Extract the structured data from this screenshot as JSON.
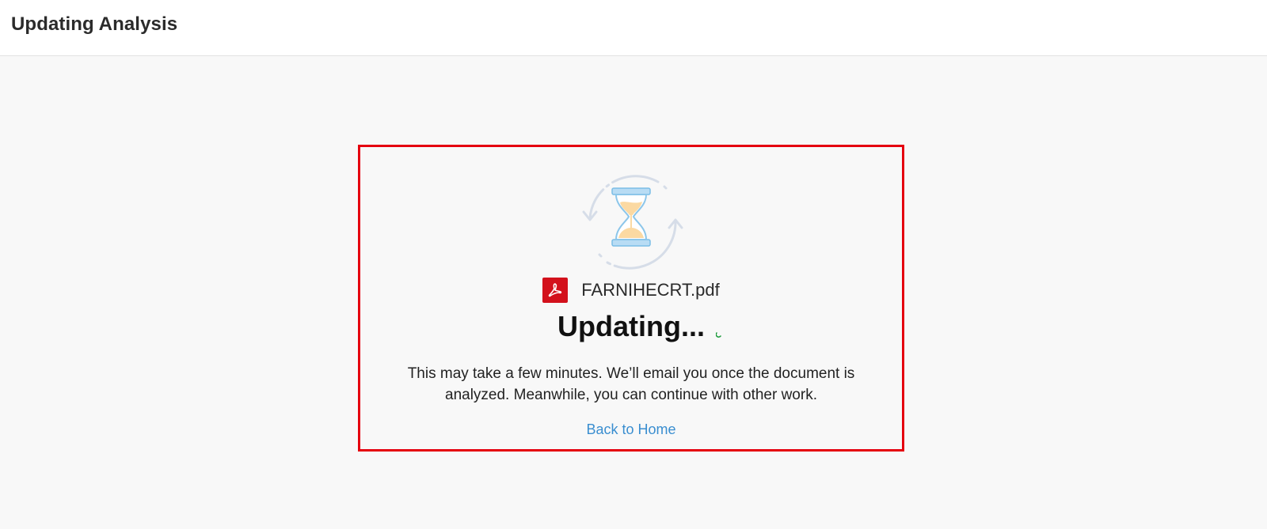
{
  "header": {
    "title": "Updating Analysis"
  },
  "card": {
    "illustration_icon": "hourglass-refresh-icon",
    "file": {
      "icon": "pdf-file-icon",
      "name": "FARNIHECRT.pdf"
    },
    "status_title": "Updating...",
    "description": "This may take a few minutes. We’ll email you once the document is analyzed. Meanwhile, you can continue with other work.",
    "back_link": "Back to Home"
  },
  "colors": {
    "highlight_border": "#e5000f",
    "pdf_icon_bg": "#d3111c",
    "link": "#3a8ed0",
    "spinner": "#1a9a3a",
    "background": "#f8f8f8",
    "header_bg": "#ffffff"
  }
}
